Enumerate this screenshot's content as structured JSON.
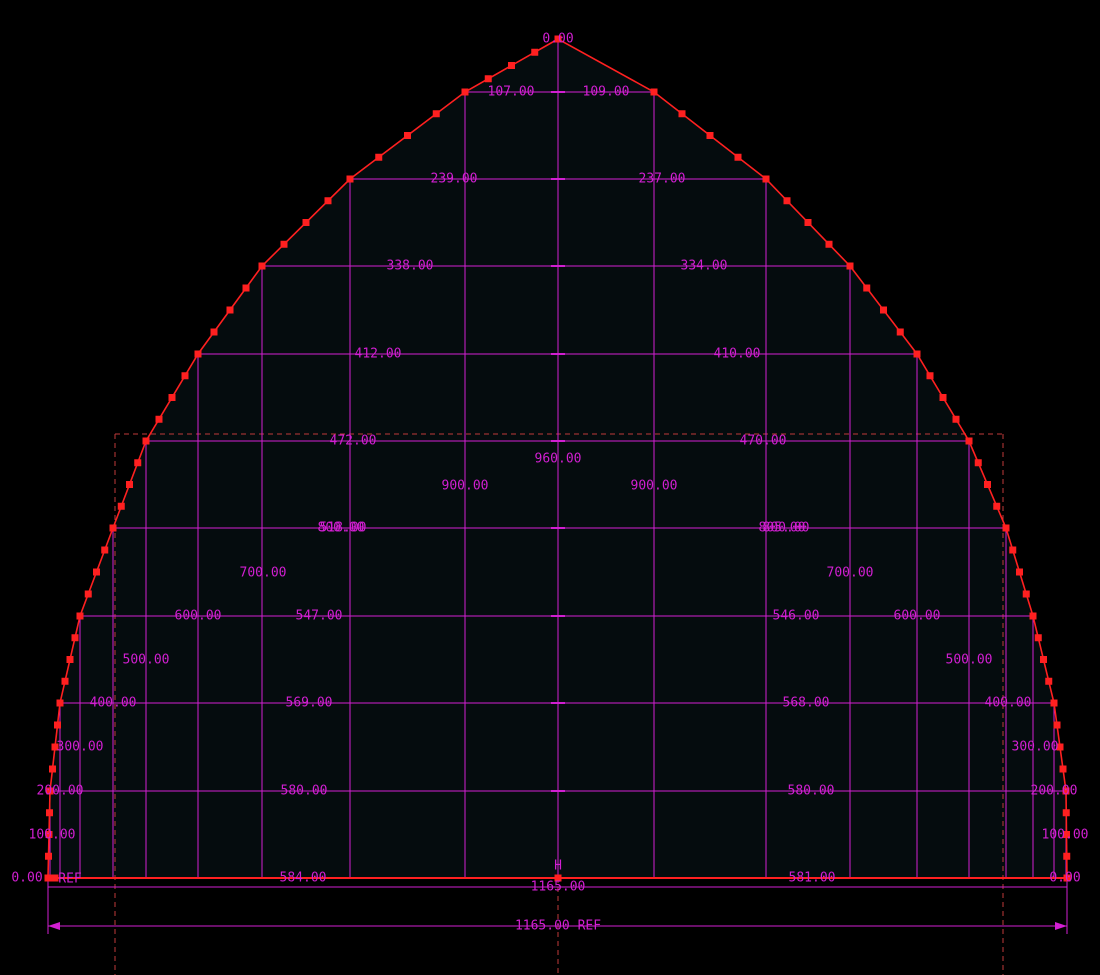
{
  "colors": {
    "background": "#000000",
    "fill": "#050c0e",
    "outline": "#ff2020",
    "dimension": "#d21fd2",
    "reference": "#c03a3a"
  },
  "drawing": {
    "apex_label": "0.00",
    "origin_marker": "H",
    "rows": [
      {
        "left_label": "107.00",
        "right_label": "109.00"
      },
      {
        "left_label": "239.00",
        "right_label": "237.00"
      },
      {
        "left_label": "338.00",
        "right_label": "334.00"
      },
      {
        "left_label": "412.00",
        "right_label": "410.00"
      },
      {
        "left_label": "472.00",
        "right_label": "470.00"
      },
      {
        "left_label": "518.00",
        "right_label": "805.00"
      },
      {
        "left_label": "547.00",
        "right_label": "546.00"
      },
      {
        "left_label": "569.00",
        "right_label": "568.00"
      },
      {
        "left_label": "580.00",
        "right_label": "580.00"
      },
      {
        "left_label": "584.00",
        "right_label": "581.00"
      }
    ],
    "height_labels": {
      "center": "960.00",
      "left": [
        "900.00",
        "800.00",
        "700.00",
        "600.00",
        "500.00",
        "400.00",
        "300.00",
        "200.00",
        "100.00",
        "0.00"
      ],
      "right": [
        "900.00",
        "800.00",
        "700.00",
        "600.00",
        "500.00",
        "400.00",
        "300.00",
        "200.00",
        "100.00",
        "0.00"
      ]
    },
    "base_ref_left": "REF",
    "total_width": "1165.00",
    "total_width_ref": "1165.00  REF"
  }
}
